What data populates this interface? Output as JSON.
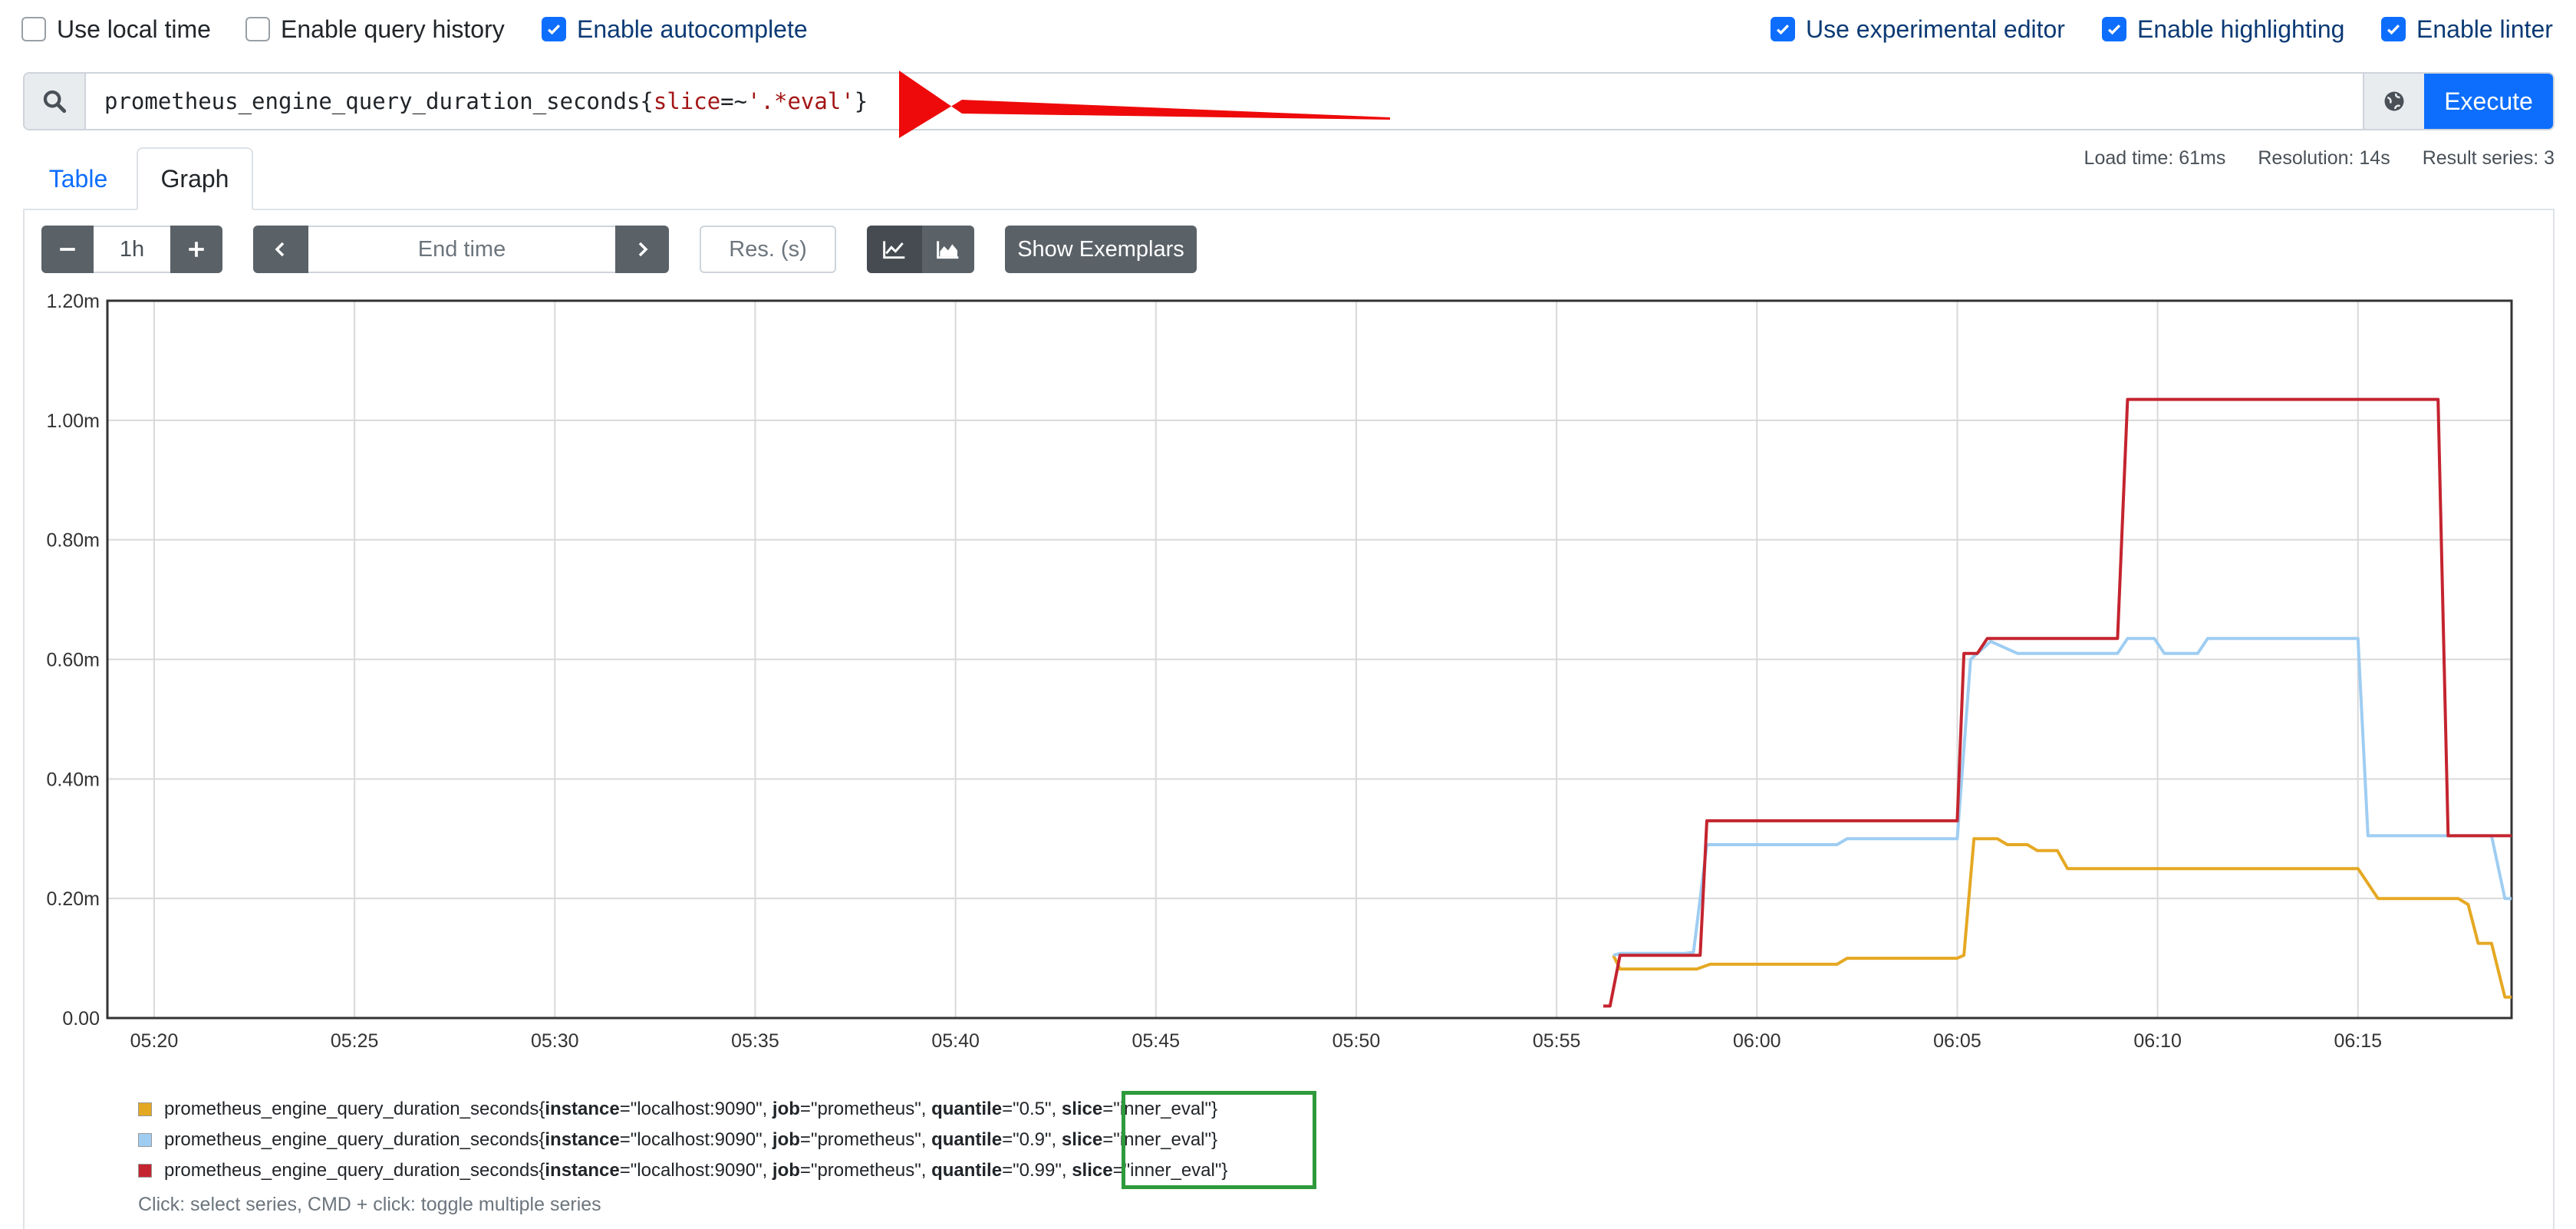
{
  "options": {
    "left": [
      {
        "label": "Use local time",
        "checked": false
      },
      {
        "label": "Enable query history",
        "checked": false
      },
      {
        "label": "Enable autocomplete",
        "checked": true
      }
    ],
    "right": [
      {
        "label": "Use experimental editor",
        "checked": true
      },
      {
        "label": "Enable highlighting",
        "checked": true
      },
      {
        "label": "Enable linter",
        "checked": true
      }
    ]
  },
  "query": {
    "metric": "prometheus_engine_query_duration_seconds",
    "brace_open": "{",
    "label": "slice",
    "op": "=~",
    "value": "'.*eval'",
    "brace_close": "}",
    "execute_label": "Execute"
  },
  "tabs": {
    "table": "Table",
    "graph": "Graph"
  },
  "stats": {
    "load_time": "Load time: 61ms",
    "resolution": "Resolution: 14s",
    "result_series": "Result series: 3"
  },
  "controls": {
    "minus": "−",
    "range": "1h",
    "plus": "+",
    "end_time_placeholder": "End time",
    "res_placeholder": "Res. (s)",
    "show_exemplars": "Show Exemplars"
  },
  "colors": {
    "yellow": "#e5a823",
    "blue": "#9fcdf2",
    "red": "#c4242f",
    "highlight": "#2e9a3c",
    "arrow": "#ee0a0a"
  },
  "chart_data": {
    "type": "line",
    "x_ticks": [
      "05:20",
      "05:25",
      "05:30",
      "05:35",
      "05:40",
      "05:45",
      "05:50",
      "05:55",
      "06:00",
      "06:05",
      "06:10",
      "06:15"
    ],
    "x_range": [
      "05:18:50",
      "06:18:50"
    ],
    "y_ticks": [
      "0.00",
      "0.20m",
      "0.40m",
      "0.60m",
      "0.80m",
      "1.00m",
      "1.20m"
    ],
    "ylim": [
      0,
      1.2
    ],
    "y_unit": "m",
    "grid": true,
    "series": [
      {
        "color_key": "yellow",
        "points": [
          [
            "05:56:25",
            0.105
          ],
          [
            "05:56:35",
            0.082
          ],
          [
            "05:58:30",
            0.082
          ],
          [
            "05:58:50",
            0.09
          ],
          [
            "06:02:00",
            0.09
          ],
          [
            "06:02:15",
            0.1
          ],
          [
            "06:05:00",
            0.1
          ],
          [
            "06:05:10",
            0.105
          ],
          [
            "06:05:25",
            0.3
          ],
          [
            "06:06:00",
            0.3
          ],
          [
            "06:06:15",
            0.29
          ],
          [
            "06:06:45",
            0.29
          ],
          [
            "06:07:00",
            0.28
          ],
          [
            "06:07:30",
            0.28
          ],
          [
            "06:07:45",
            0.25
          ],
          [
            "06:15:00",
            0.25
          ],
          [
            "06:15:30",
            0.2
          ],
          [
            "06:17:30",
            0.2
          ],
          [
            "06:17:45",
            0.19
          ],
          [
            "06:18:00",
            0.125
          ],
          [
            "06:18:20",
            0.125
          ],
          [
            "06:18:40",
            0.035
          ],
          [
            "06:18:50",
            0.035
          ]
        ]
      },
      {
        "color_key": "blue",
        "points": [
          [
            "05:56:25",
            0.105
          ],
          [
            "05:56:35",
            0.108
          ],
          [
            "05:58:10",
            0.108
          ],
          [
            "05:58:25",
            0.11
          ],
          [
            "05:58:45",
            0.29
          ],
          [
            "06:02:00",
            0.29
          ],
          [
            "06:02:15",
            0.3
          ],
          [
            "06:05:00",
            0.3
          ],
          [
            "06:05:20",
            0.6
          ],
          [
            "06:05:50",
            0.63
          ],
          [
            "06:06:30",
            0.61
          ],
          [
            "06:09:00",
            0.61
          ],
          [
            "06:09:15",
            0.635
          ],
          [
            "06:09:55",
            0.635
          ],
          [
            "06:10:10",
            0.61
          ],
          [
            "06:11:00",
            0.61
          ],
          [
            "06:11:15",
            0.635
          ],
          [
            "06:15:00",
            0.635
          ],
          [
            "06:15:15",
            0.305
          ],
          [
            "06:18:20",
            0.305
          ],
          [
            "06:18:40",
            0.2
          ],
          [
            "06:18:50",
            0.2
          ]
        ]
      },
      {
        "color_key": "red",
        "points": [
          [
            "05:56:10",
            0.02
          ],
          [
            "05:56:20",
            0.02
          ],
          [
            "05:56:35",
            0.105
          ],
          [
            "05:58:35",
            0.105
          ],
          [
            "05:58:45",
            0.33
          ],
          [
            "06:05:00",
            0.33
          ],
          [
            "06:05:10",
            0.61
          ],
          [
            "06:05:30",
            0.61
          ],
          [
            "06:05:45",
            0.635
          ],
          [
            "06:09:00",
            0.635
          ],
          [
            "06:09:15",
            1.035
          ],
          [
            "06:17:00",
            1.035
          ],
          [
            "06:17:15",
            0.305
          ],
          [
            "06:18:50",
            0.305
          ]
        ]
      }
    ]
  },
  "legend": [
    {
      "color_key": "yellow",
      "metric": "prometheus_engine_query_duration_seconds",
      "instance": "\"localhost:9090\"",
      "job": "\"prometheus\"",
      "quantile": "\"0.5\"",
      "slice": "\"inner_eval\""
    },
    {
      "color_key": "blue",
      "metric": "prometheus_engine_query_duration_seconds",
      "instance": "\"localhost:9090\"",
      "job": "\"prometheus\"",
      "quantile": "\"0.9\"",
      "slice": "\"inner_eval\""
    },
    {
      "color_key": "red",
      "metric": "prometheus_engine_query_duration_seconds",
      "instance": "\"localhost:9090\"",
      "job": "\"prometheus\"",
      "quantile": "\"0.99\"",
      "slice": "\"inner_eval\""
    }
  ],
  "legend_keys": {
    "instance": "instance",
    "job": "job",
    "quantile": "quantile",
    "slice": "slice"
  },
  "hint": "Click: select series, CMD + click: toggle multiple series"
}
